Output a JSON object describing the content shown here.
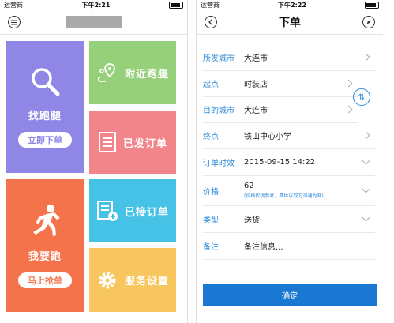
{
  "left": {
    "status": {
      "carrier": "运营商",
      "time": "下午2:21"
    },
    "tiles": {
      "find_runner": {
        "label": "找跑腿",
        "button": "立即下单",
        "color": "#8f86e6"
      },
      "nearby": {
        "label": "附近跑腿",
        "color": "#97d07a"
      },
      "sent_orders": {
        "label": "已发订单",
        "color": "#f2858a"
      },
      "i_run": {
        "label": "我要跑",
        "button": "马上抢单",
        "color": "#f5734a"
      },
      "accepted_orders": {
        "label": "已接订单",
        "color": "#45c2e6"
      },
      "service_settings": {
        "label": "服务设置",
        "color": "#f7c65e"
      }
    }
  },
  "right": {
    "status": {
      "carrier": "运营商",
      "time": "下午2:22"
    },
    "title": "下单",
    "form": {
      "departure_city": {
        "label": "所发城市",
        "value": "大连市"
      },
      "start": {
        "label": "起点",
        "value": "时装店"
      },
      "dest_city": {
        "label": "目的城市",
        "value": "大连市"
      },
      "end": {
        "label": "终点",
        "value": "铁山中心小学"
      },
      "order_time": {
        "label": "订单时效",
        "value": "2015-09-15 14:22"
      },
      "price": {
        "label": "价格",
        "value": "62",
        "hint": "(价格仅供参考，具体以双方沟通为准)"
      },
      "type": {
        "label": "类型",
        "value": "送货"
      },
      "note": {
        "label": "备注",
        "placeholder": "备注信息..."
      }
    },
    "confirm_label": "确定",
    "accent": "#2b88d8"
  }
}
